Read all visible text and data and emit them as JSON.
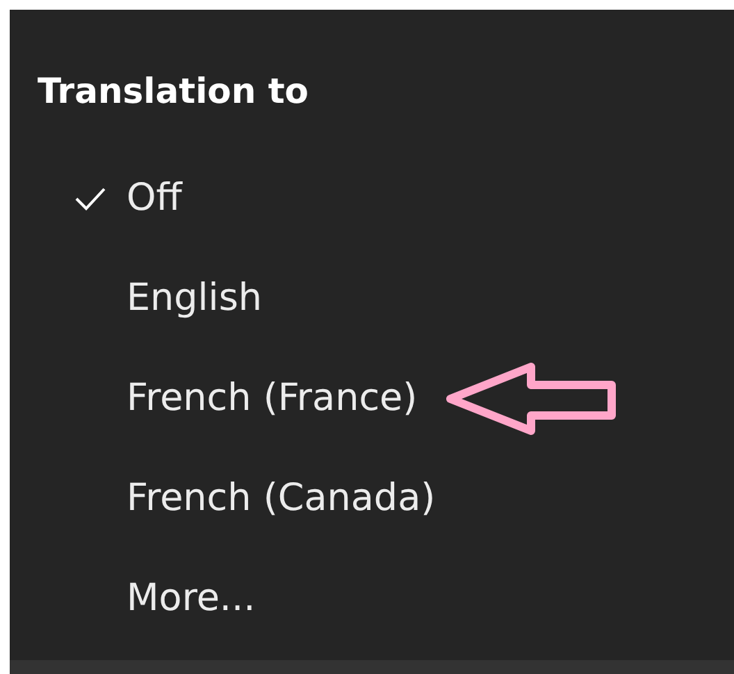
{
  "menu": {
    "title": "Translation to",
    "items": [
      {
        "label": "Off",
        "selected": true,
        "marked": false
      },
      {
        "label": "English",
        "selected": false,
        "marked": false
      },
      {
        "label": "French (France)",
        "selected": false,
        "marked": true
      },
      {
        "label": "French (Canada)",
        "selected": false,
        "marked": false
      },
      {
        "label": "More...",
        "selected": false,
        "marked": false
      }
    ]
  }
}
